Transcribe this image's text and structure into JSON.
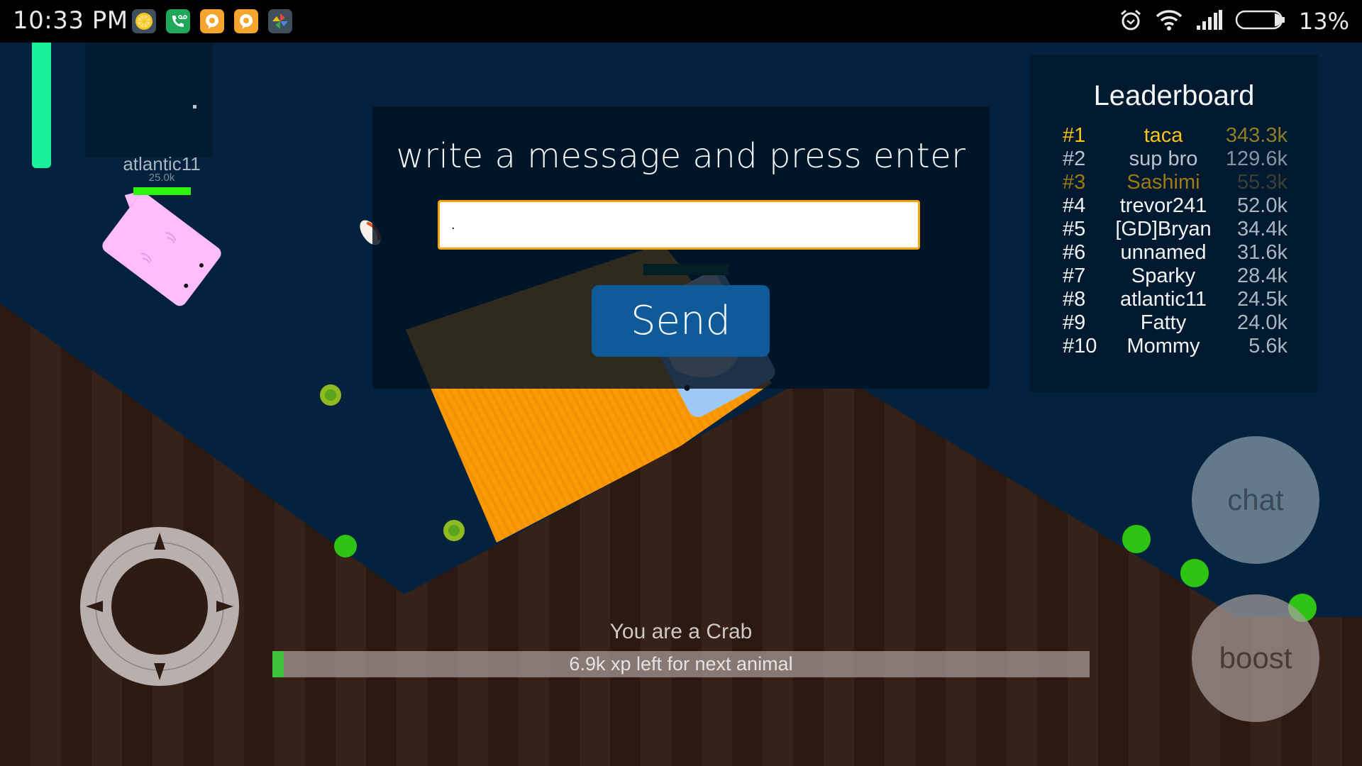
{
  "status_bar": {
    "time": "10:33 PM",
    "notification_icons": [
      {
        "name": "lemon-app-icon",
        "color": "#f5c61c",
        "bg": "#3f4f5c"
      },
      {
        "name": "voicemail-app-icon",
        "color": "#ffffff",
        "bg": "#1fa85a"
      },
      {
        "name": "chat-app-icon",
        "color": "#ffffff",
        "bg": "#f5a42d"
      },
      {
        "name": "chat-app-icon-2",
        "color": "#ffffff",
        "bg": "#f5a42d"
      },
      {
        "name": "pinwheel-app-icon",
        "color": "#e84a3c",
        "bg": "#3f4f5c"
      }
    ],
    "battery_percent": "13%",
    "battery_level": 0.13
  },
  "player": {
    "name": "atlantic11",
    "score": "25.0k",
    "health_fraction": 1.0
  },
  "chat": {
    "prompt": "write a message and press enter",
    "input_value": ".",
    "input_placeholder": "",
    "send_label": "Send"
  },
  "leaderboard": {
    "title": "Leaderboard",
    "rows": [
      {
        "rank": "#1",
        "name": "taca",
        "score": "343.3k",
        "tier": "gold"
      },
      {
        "rank": "#2",
        "name": "sup bro",
        "score": "129.6k",
        "tier": "silver"
      },
      {
        "rank": "#3",
        "name": "Sashimi",
        "score": "55.3k",
        "tier": "bronze"
      },
      {
        "rank": "#4",
        "name": "trevor241",
        "score": "52.0k",
        "tier": ""
      },
      {
        "rank": "#5",
        "name": "[GD]Bryan",
        "score": "34.4k",
        "tier": ""
      },
      {
        "rank": "#6",
        "name": "unnamed",
        "score": "31.6k",
        "tier": ""
      },
      {
        "rank": "#7",
        "name": "Sparky",
        "score": "28.4k",
        "tier": ""
      },
      {
        "rank": "#8",
        "name": "atlantic11",
        "score": "24.5k",
        "tier": ""
      },
      {
        "rank": "#9",
        "name": "Fatty",
        "score": "24.0k",
        "tier": ""
      },
      {
        "rank": "#10",
        "name": "Mommy",
        "score": "5.6k",
        "tier": ""
      }
    ]
  },
  "controls": {
    "chat_label": "chat",
    "boost_label": "boost"
  },
  "progress": {
    "animal_label": "You are a Crab",
    "xp_text": "6.9k xp left for next animal",
    "fraction": 0.014
  },
  "colors": {
    "water": "#04223d",
    "terrain_dark": "#2c1a12",
    "terrain_light": "#362218",
    "accent_input_border": "#f5a30f",
    "send_button": "#0f5b9a",
    "boost_meter": "#1af29a",
    "xp_fill": "#3fc23c",
    "food_green": "#2fc414",
    "food_olive": "#8fba1f"
  }
}
